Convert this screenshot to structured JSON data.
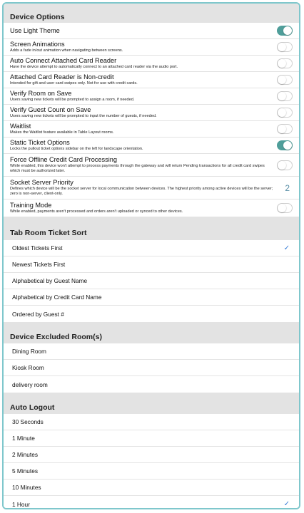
{
  "sections": {
    "device_options": "Device Options",
    "tab_room_sort": "Tab Room Ticket Sort",
    "excluded_rooms": "Device Excluded Room(s)",
    "auto_logout": "Auto Logout"
  },
  "options": [
    {
      "title": "Use Light Theme",
      "desc": "",
      "state": "on"
    },
    {
      "title": "Screen Animations",
      "desc": "Adds a fade in/out animation when navigating between screens.",
      "state": "off"
    },
    {
      "title": "Auto Connect Attached Card Reader",
      "desc": "Have the device attempt to automatically connect to an attached card reader via the audio port.",
      "state": "off"
    },
    {
      "title": "Attached Card Reader is Non-credit",
      "desc": "Intended for gift and user card swipes only. Not for use with credit cards.",
      "state": "off"
    },
    {
      "title": "Verify Room on Save",
      "desc": "Users saving new tickets will be prompted to assign a room, if needed.",
      "state": "off"
    },
    {
      "title": "Verify Guest Count on Save",
      "desc": "Users saving new tickets will be prompted to input the number of guests, if needed.",
      "state": "off"
    },
    {
      "title": "Waitlist",
      "desc": "Makes the Waitlist feature available in Table Layout rooms.",
      "state": "off"
    },
    {
      "title": "Static Ticket Options",
      "desc": "Locks the pullout ticket options sidebar on the left for landscape orientation.",
      "state": "on"
    },
    {
      "title": "Force Offline Credit Card Processing",
      "desc": "While enabled, this device won't attempt to process payments through the gateway and will return Pending transactions for all credit card swipes which must be authorized later.",
      "state": "off"
    },
    {
      "title": "Socket Server Priority",
      "desc": "Defines which device will be the socket server for local communication between devices. The highest priority among active devices will be the server; zero is non-server, client-only.",
      "value": "2"
    },
    {
      "title": "Training Mode",
      "desc": "While enabled, payments aren't processed and orders aren't uploaded or synced to other devices.",
      "state": "off"
    }
  ],
  "sort_options": [
    {
      "label": "Oldest Tickets First",
      "selected": true
    },
    {
      "label": "Newest Tickets First",
      "selected": false
    },
    {
      "label": "Alphabetical by Guest Name",
      "selected": false
    },
    {
      "label": "Alphabetical by Credit Card Name",
      "selected": false
    },
    {
      "label": "Ordered by Guest #",
      "selected": false
    }
  ],
  "rooms": [
    "Dining Room",
    "Kiosk Room",
    "delivery room"
  ],
  "logout_options": [
    {
      "label": "30 Seconds",
      "selected": false
    },
    {
      "label": "1 Minute",
      "selected": false
    },
    {
      "label": "2 Minutes",
      "selected": false
    },
    {
      "label": "5 Minutes",
      "selected": false
    },
    {
      "label": "10 Minutes",
      "selected": false
    },
    {
      "label": "1 Hour",
      "selected": true
    }
  ],
  "check_glyph": "✓",
  "colors": {
    "toggle_on": "#4f9e9a",
    "check": "#3a7fd8",
    "border": "#7fc7cc"
  }
}
